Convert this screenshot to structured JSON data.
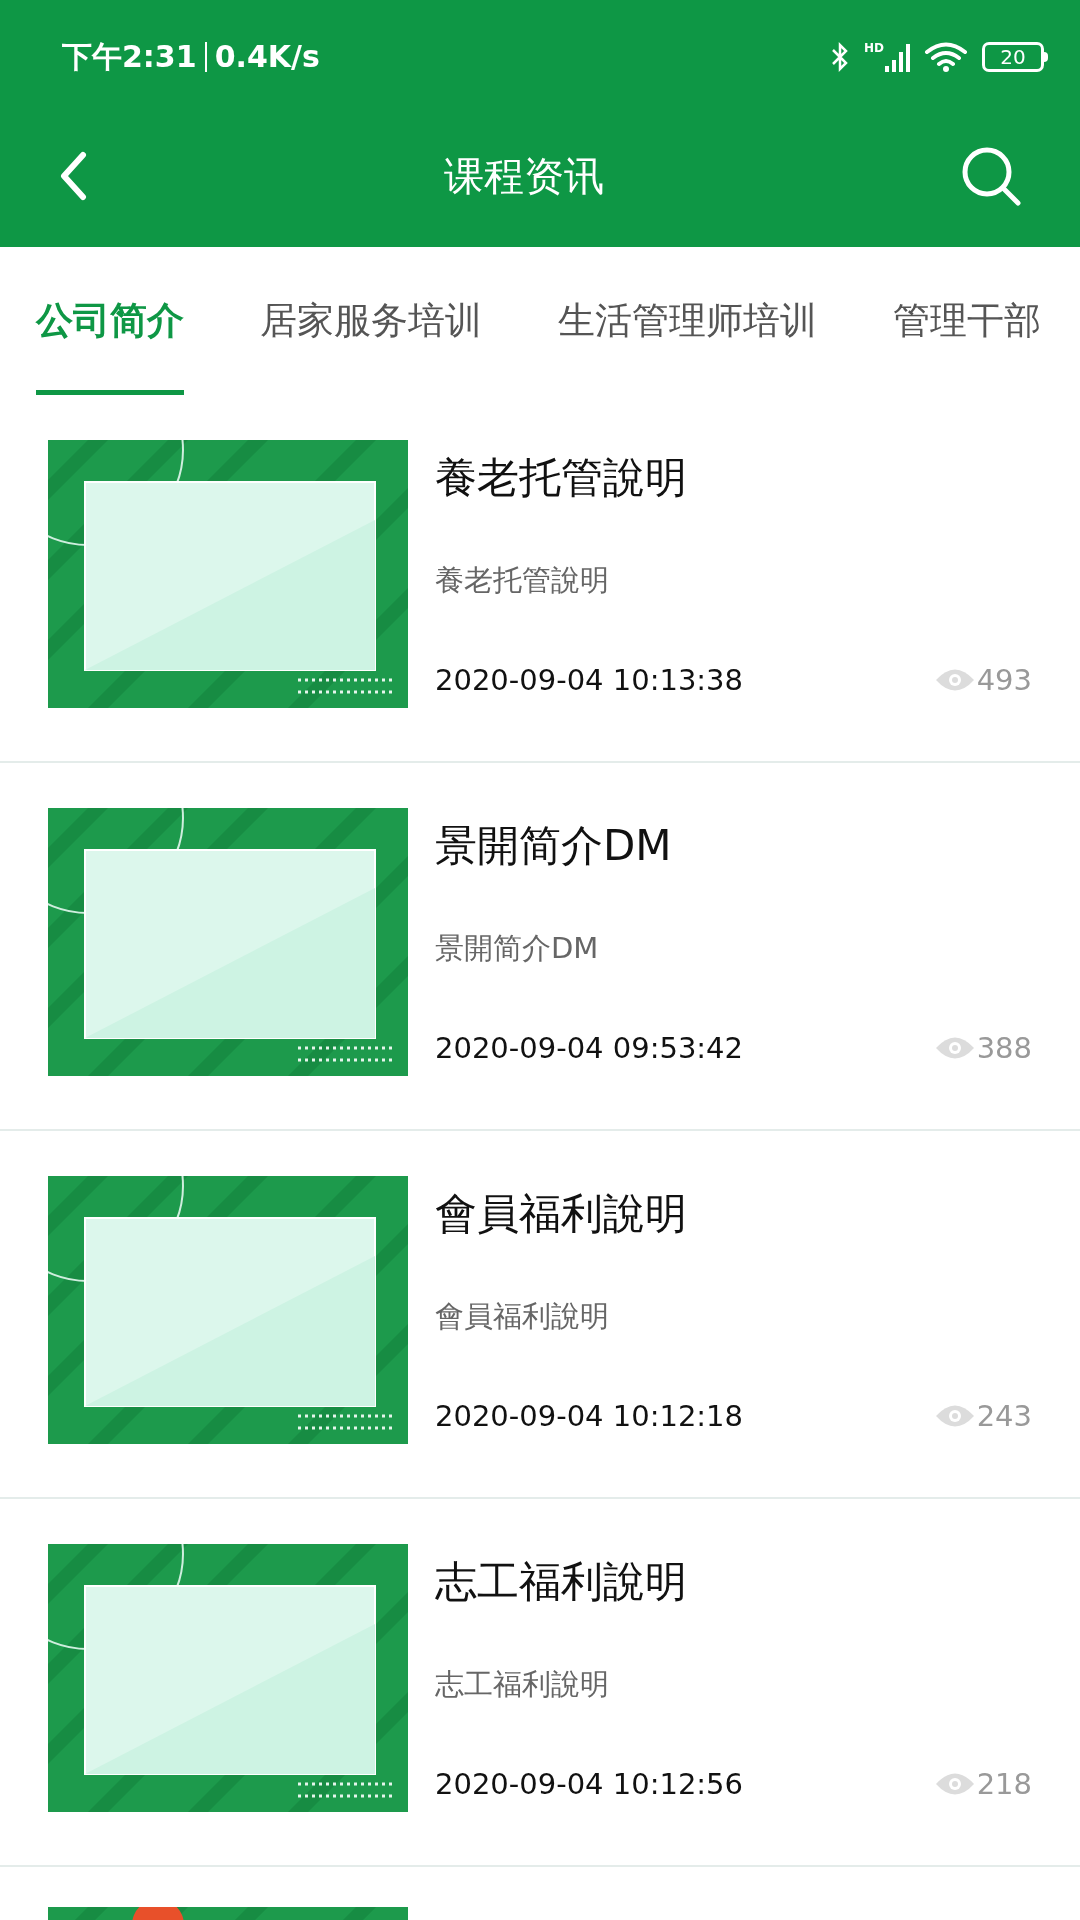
{
  "status_bar": {
    "time": "下午2:31",
    "speed": "0.4K/s",
    "network_badge": "HD",
    "battery": "20"
  },
  "header": {
    "title": "课程资讯"
  },
  "tabs": [
    {
      "label": "公司简介",
      "selected": true
    },
    {
      "label": "居家服务培训",
      "selected": false
    },
    {
      "label": "生活管理师培训",
      "selected": false
    },
    {
      "label": "管理干部",
      "selected": false
    }
  ],
  "articles": [
    {
      "title": "養老托管說明",
      "summary": "養老托管說明",
      "date": "2020-09-04 10:13:38",
      "views": "493",
      "thumbnail": {
        "kind": "picture"
      }
    },
    {
      "title": "景開简介DM",
      "summary": "景開简介DM",
      "date": "2020-09-04 09:53:42",
      "views": "388",
      "thumbnail": {
        "kind": "picture"
      }
    },
    {
      "title": "會員福利說明",
      "summary": "會員福利說明",
      "date": "2020-09-04 10:12:18",
      "views": "243",
      "thumbnail": {
        "kind": "picture"
      }
    },
    {
      "title": "志工福利說明",
      "summary": "志工福利說明",
      "date": "2020-09-04 10:12:56",
      "views": "218",
      "thumbnail": {
        "kind": "picture"
      }
    },
    {
      "thumbnail": {
        "kind": "picture"
      }
    }
  ]
}
